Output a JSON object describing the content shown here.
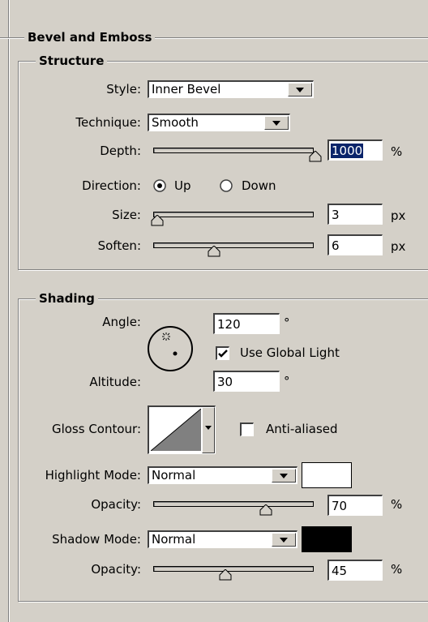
{
  "bevel": {
    "title": "Bevel and Emboss",
    "structure": {
      "title": "Structure",
      "style": {
        "label": "Style:",
        "value": "Inner Bevel"
      },
      "technique": {
        "label": "Technique:",
        "value": "Smooth"
      },
      "depth": {
        "label": "Depth:",
        "value": "1000",
        "unit": "%",
        "slider_fraction": 1.0
      },
      "direction": {
        "label": "Direction:",
        "options": [
          "Up",
          "Down"
        ],
        "selected": "Up"
      },
      "size": {
        "label": "Size:",
        "value": "3",
        "unit": "px",
        "slider_fraction": 0.02
      },
      "soften": {
        "label": "Soften:",
        "value": "6",
        "unit": "px",
        "slider_fraction": 0.375
      }
    },
    "shading": {
      "title": "Shading",
      "angle": {
        "label": "Angle:",
        "value": "120",
        "unit": "°"
      },
      "use_global_light": {
        "label": "Use Global Light",
        "checked": true
      },
      "altitude": {
        "label": "Altitude:",
        "value": "30",
        "unit": "°"
      },
      "gloss_contour": {
        "label": "Gloss Contour:",
        "icon": "contour-ramp-icon"
      },
      "anti_aliased": {
        "label": "Anti-aliased",
        "checked": false
      },
      "highlight_mode": {
        "label": "Highlight Mode:",
        "value": "Normal",
        "color": "#ffffff"
      },
      "highlight_opacity": {
        "label": "Opacity:",
        "value": "70",
        "unit": "%",
        "slider_fraction": 0.7
      },
      "shadow_mode": {
        "label": "Shadow Mode:",
        "value": "Normal",
        "color": "#000000"
      },
      "shadow_opacity": {
        "label": "Opacity:",
        "value": "45",
        "unit": "%",
        "slider_fraction": 0.45
      }
    }
  }
}
